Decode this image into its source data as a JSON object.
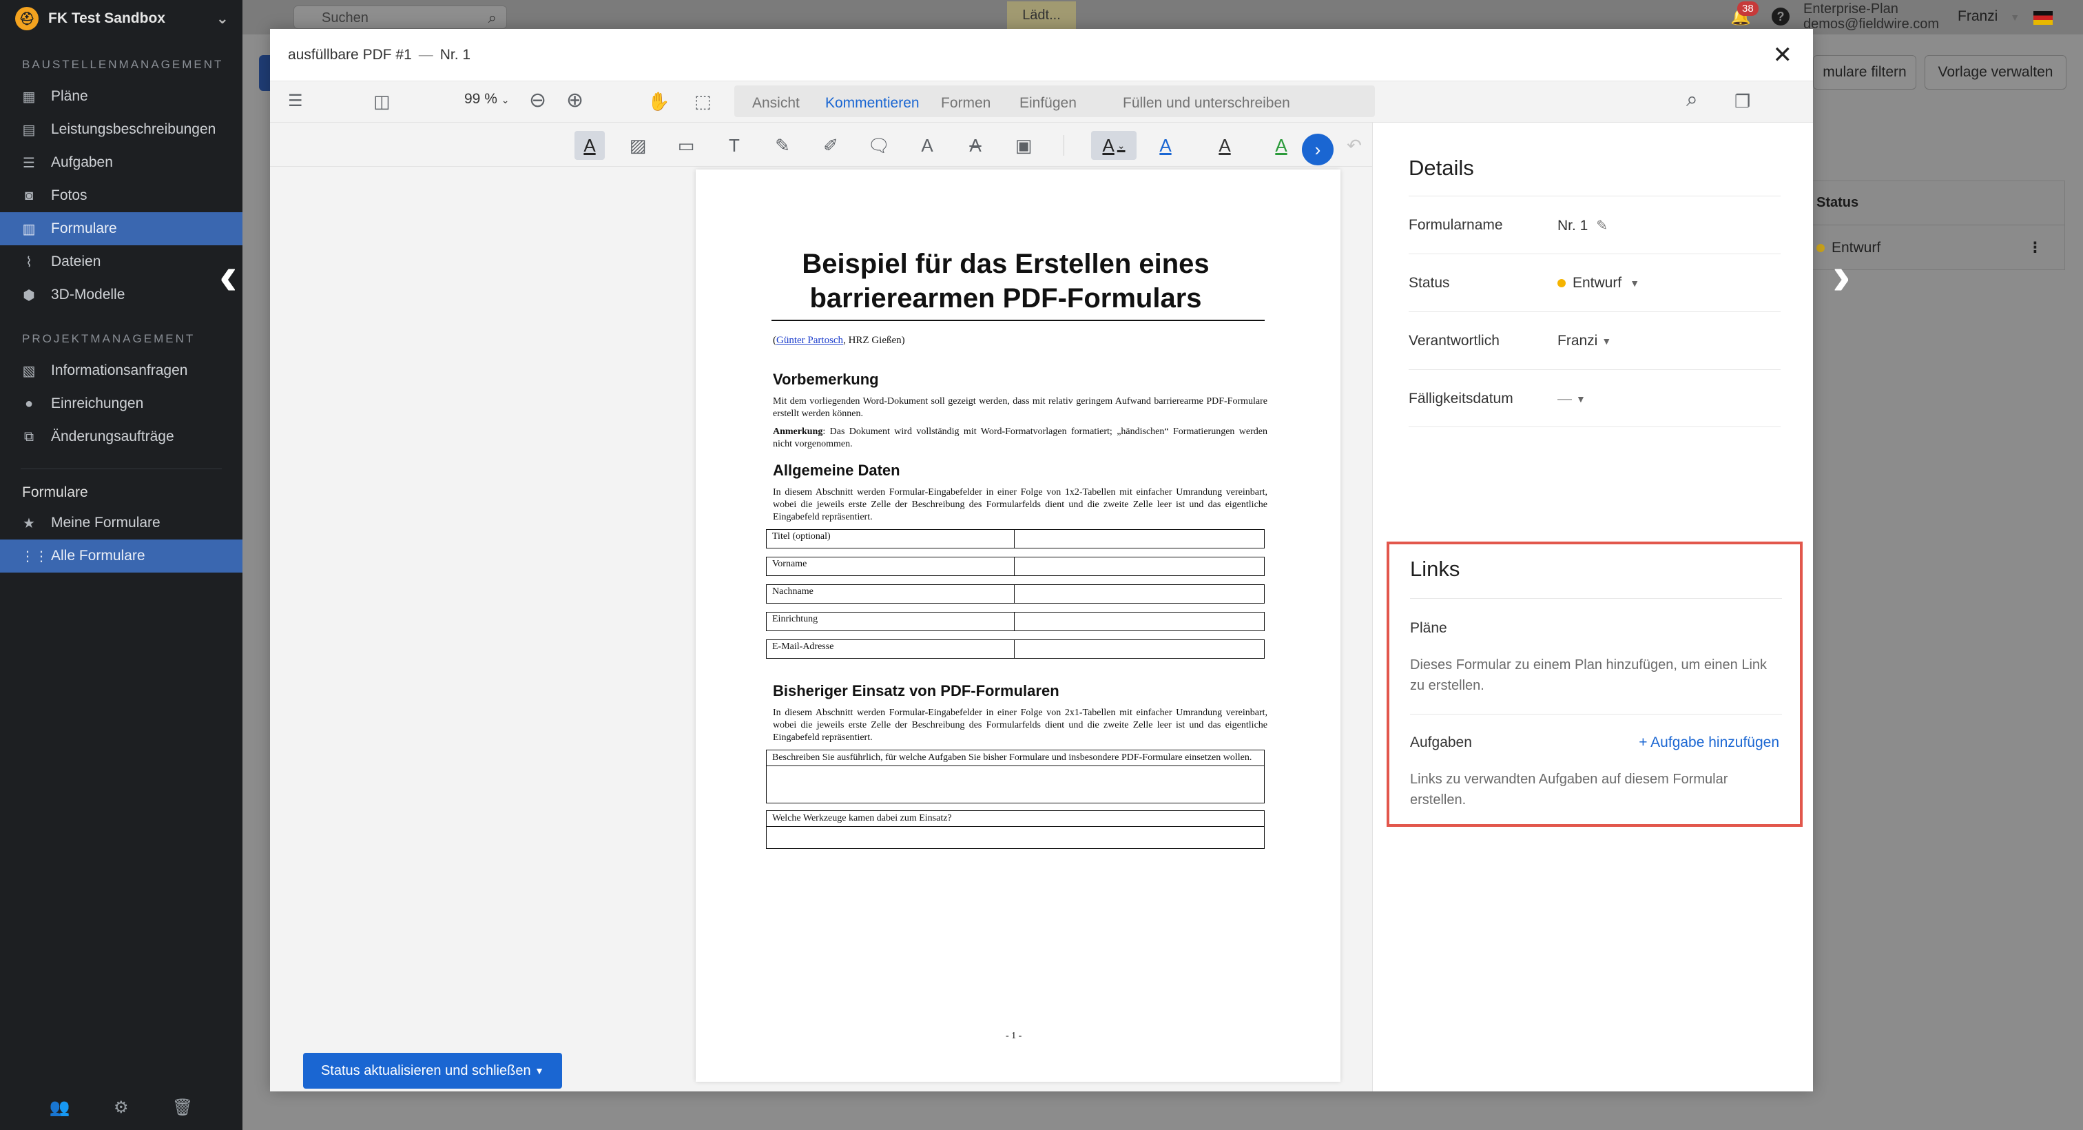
{
  "sidebar": {
    "project_name": "FK Test Sandbox",
    "section_construction": "BAUSTELLENMANAGEMENT",
    "construction_items": [
      {
        "label": "Pläne",
        "icon": "plans-icon"
      },
      {
        "label": "Leistungsbeschreibungen",
        "icon": "specs-icon"
      },
      {
        "label": "Aufgaben",
        "icon": "tasks-icon"
      },
      {
        "label": "Fotos",
        "icon": "camera-icon"
      },
      {
        "label": "Formulare",
        "icon": "forms-icon"
      },
      {
        "label": "Dateien",
        "icon": "paperclip-icon"
      },
      {
        "label": "3D-Modelle",
        "icon": "cube-icon"
      }
    ],
    "section_project": "PROJEKTMANAGEMENT",
    "project_items": [
      {
        "label": "Informationsanfragen",
        "icon": "rfi-icon"
      },
      {
        "label": "Einreichungen",
        "icon": "submittal-icon"
      },
      {
        "label": "Änderungsaufträge",
        "icon": "change-order-icon"
      }
    ],
    "forms_heading": "Formulare",
    "forms_items": [
      {
        "label": "Meine Formulare",
        "icon": "star-icon"
      },
      {
        "label": "Alle Formulare",
        "icon": "grid-icon"
      }
    ]
  },
  "topbar": {
    "search_placeholder": "Suchen",
    "loading": "Lädt...",
    "notification_count": "38",
    "plan_name": "Enterprise-Plan",
    "email": "demos@fieldwire.com",
    "user": "Franzi"
  },
  "background": {
    "filter_button": "mulare filtern",
    "template_button": "Vorlage verwalten",
    "table_header": "Status",
    "table_status": "Entwurf"
  },
  "modal": {
    "file_name": "ausfüllbare PDF #1",
    "separator": "—",
    "form_number": "Nr. 1",
    "zoom": "99 %",
    "tabs": [
      "Ansicht",
      "Kommentieren",
      "Formen",
      "Einfügen",
      "Füllen und unterschreiben"
    ],
    "active_tab": "Kommentieren",
    "status_button": "Status aktualisieren und schließen"
  },
  "pdf": {
    "title_line1": "Beispiel für das Erstellen eines",
    "title_line2": "barrierearmen PDF-Formulars",
    "author_link": "Günter Partosch",
    "author_rest": ", HRZ Gießen)",
    "author_open": "(",
    "h_pre": "Vorbemerkung",
    "p_pre": "Mit dem vorliegenden Word-Dokument soll gezeigt werden, dass mit relativ geringem Aufwand barrierearme PDF-Formulare erstellt werden können.",
    "note_label": "Anmerkung",
    "note_text": ": Das Dokument wird vollständig mit Word-Formatvorlagen formatiert; „händischen“ Formatierungen werden nicht vorgenommen.",
    "h_general": "Allgemeine Daten",
    "p_general": "In diesem Abschnitt werden Formular-Eingabefelder in einer Folge von 1x2-Tabellen mit einfacher Umrandung vereinbart, wobei die jeweils erste Zelle der Beschreibung des Formularfelds dient und die zweite Zelle leer ist und das eigentliche Eingabefeld repräsentiert.",
    "fields": [
      "Titel (optional)",
      "Vorname",
      "Nachname",
      "Einrichtung",
      "E-Mail-Adresse"
    ],
    "h_prev": "Bisheriger Einsatz von PDF-Formularen",
    "p_prev": "In diesem Abschnitt werden Formular-Eingabefelder in einer Folge von 2x1-Tabellen mit einfacher Umrandung vereinbart, wobei die jeweils erste Zelle der Beschreibung des Formularfelds dient und die zweite Zelle leer ist und das eigentliche Eingabefeld repräsentiert.",
    "q1": "Beschreiben Sie ausführlich, für welche Aufgaben Sie bisher Formulare und insbesondere PDF-Formulare einsetzen wollen.",
    "q2": "Welche Werkzeuge kamen dabei zum Einsatz?",
    "page_number": "- 1 -"
  },
  "details": {
    "title": "Details",
    "rows": [
      {
        "label": "Formularname",
        "value": "Nr. 1"
      },
      {
        "label": "Status",
        "value": "Entwurf",
        "status_color": "#f5b400"
      },
      {
        "label": "Verantwortlich",
        "value": "Franzi"
      },
      {
        "label": "Fälligkeitsdatum",
        "value": "—"
      }
    ]
  },
  "links": {
    "title": "Links",
    "plans_label": "Pläne",
    "plans_desc": "Dieses Formular zu einem Plan hinzufügen, um einen Link zu erstellen.",
    "tasks_label": "Aufgaben",
    "add_task": "+ Aufgabe hinzufügen",
    "tasks_desc": "Links zu verwandten Aufgaben auf diesem Formular erstellen.",
    "highlight_color": "#e2574c"
  },
  "colors": {
    "accent": "#1a66d2",
    "sidebar_bg": "#1d1f22",
    "sidebar_active": "#3a67b0"
  }
}
